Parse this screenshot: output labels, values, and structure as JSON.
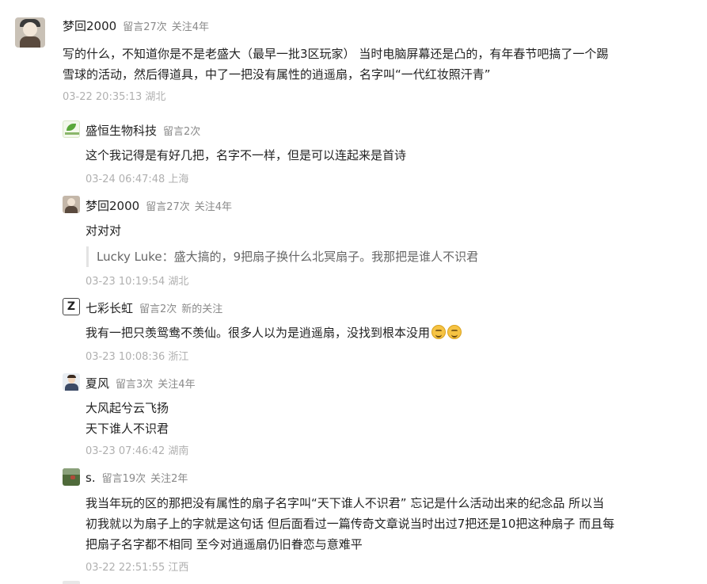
{
  "main": {
    "username": "梦回2000",
    "comment_count": "留言27次",
    "follow_duration": "关注4年",
    "text_line1": "写的什么，不知道你是不是老盛大（最早一批3区玩家） 当时电脑屏幕还是凸的，有年春节吧搞了一个踢",
    "text_line2": "雪球的活动，然后得道具，中了一把没有属性的逍遥扇，名字叫“一代红妆照汗青”",
    "time": "03-22 20:35:13 湖北"
  },
  "replies": [
    {
      "username": "盛恒生物科技",
      "meta1": "留言2次",
      "meta2": "",
      "lines": [
        "这个我记得是有好几把，名字不一样，但是可以连起来是首诗"
      ],
      "time": "03-24 06:47:48 上海",
      "avatar": "company-logo"
    },
    {
      "username": "梦回2000",
      "meta1": "留言27次",
      "meta2": "关注4年",
      "lines": [
        "对对对"
      ],
      "quote": "Lucky Luke：盛大搞的，9把扇子换什么北冥扇子。我那把是谁人不识君",
      "time": "03-23 10:19:54 湖北",
      "avatar": "user-photo"
    },
    {
      "username": "七彩长虹",
      "meta1": "留言2次",
      "meta2": "新的关注",
      "lines": [
        "我有一把只羡鸳鸯不羡仙。很多人以为是逍遥扇，没找到根本没用"
      ],
      "time": "03-23 10:08:36 浙江",
      "avatar": "letter-z",
      "avatar_letter": "Z",
      "emojis": [
        "smile-emoji",
        "smile-emoji"
      ]
    },
    {
      "username": "夏风",
      "meta1": "留言3次",
      "meta2": "关注4年",
      "lines": [
        "大风起兮云飞扬",
        "天下谁人不识君"
      ],
      "time": "03-23 07:46:42 湖南",
      "avatar": "man-portrait"
    },
    {
      "username": "s.",
      "meta1": "留言19次",
      "meta2": "关注2年",
      "lines": [
        "我当年玩的区的那把没有属性的扇子名字叫“天下谁人不识君”  忘记是什么活动出来的纪念品 所以当",
        "初我就以为扇子上的字就是这句话 但后面看过一篇传奇文章说当时出过7把还是10把这种扇子 而且每",
        "把扇子名字都不相同  至今对逍遥扇仍旧眷恋与意难平"
      ],
      "time": "03-22 22:51:55 江西",
      "avatar": "landscape-photo"
    }
  ]
}
